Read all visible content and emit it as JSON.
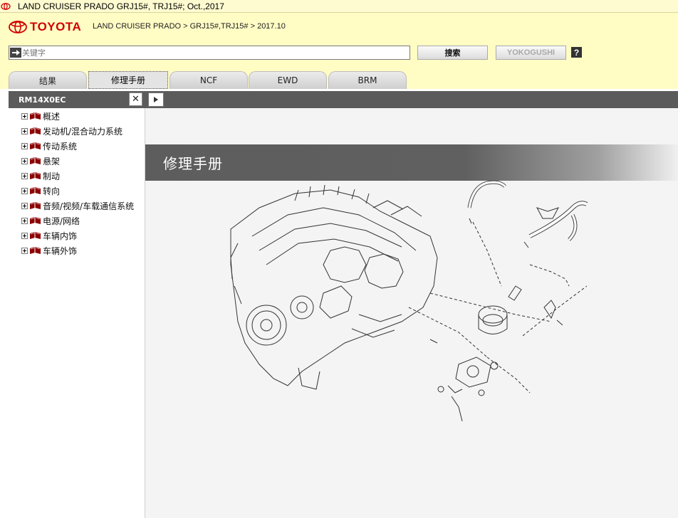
{
  "window": {
    "title": "LAND CRUISER PRADO  GRJ15#, TRJ15#; Oct.,2017"
  },
  "header": {
    "brand": "TOYOTA",
    "breadcrumb": "LAND CRUISER PRADO > GRJ15#,TRJ15# > 2017.10",
    "search_placeholder": "关键字",
    "search_button": "搜索",
    "yokogushi_button": "YOKOGUSHI",
    "help": "?"
  },
  "tabs": [
    {
      "label": "结果"
    },
    {
      "label": "修理手册",
      "active": true
    },
    {
      "label": "NCF"
    },
    {
      "label": "EWD"
    },
    {
      "label": "BRM"
    }
  ],
  "panel": {
    "id": "RM14X0EC",
    "items": [
      {
        "label": "概述"
      },
      {
        "label": "发动机/混合动力系统"
      },
      {
        "label": "传动系统"
      },
      {
        "label": "悬架"
      },
      {
        "label": "制动"
      },
      {
        "label": "转向"
      },
      {
        "label": "音频/视频/车载通信系统"
      },
      {
        "label": "电源/网络"
      },
      {
        "label": "车辆内饰"
      },
      {
        "label": "车辆外饰"
      }
    ]
  },
  "main": {
    "banner_title": "修理手册"
  },
  "colors": {
    "brand_red": "#d00000",
    "header_bg": "#fffcc4",
    "panel_dark": "#5b5b5b"
  }
}
